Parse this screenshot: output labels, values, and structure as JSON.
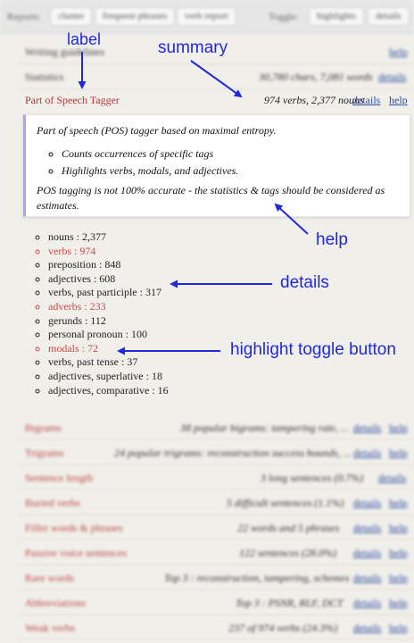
{
  "toolbar": {
    "reports_label": "Reports:",
    "buttons": [
      "cluster",
      "frequent phrases",
      "verb report"
    ],
    "toggle_label": "Toggle:",
    "toggles": [
      "highlights",
      "details"
    ]
  },
  "top_rows": [
    {
      "label": "Writing guidelines",
      "summary": "",
      "details": "",
      "help": "help"
    },
    {
      "label": "Statistics",
      "summary": "30,780 chars, 7,081 words",
      "details": "details",
      "help": ""
    }
  ],
  "tagger": {
    "label": "Part of Speech Tagger",
    "summary": "974 verbs, 2,377 nouns",
    "details": "details",
    "help": "help"
  },
  "help_box": {
    "intro": "Part of speech (POS) tagger based on maximal entropy.",
    "bullets": [
      "Counts occurrences of specific tags",
      "Highlights verbs, modals, and adjectives."
    ],
    "note": "POS tagging is not 100% accurate - the statistics & tags should be considered as estimates."
  },
  "counts": [
    {
      "text": "nouns : 2,377",
      "highlight": false
    },
    {
      "text": "verbs : 974",
      "highlight": true
    },
    {
      "text": "preposition : 848",
      "highlight": false
    },
    {
      "text": "adjectives : 608",
      "highlight": false
    },
    {
      "text": "verbs, past participle : 317",
      "highlight": false
    },
    {
      "text": "adverbs : 233",
      "highlight": true
    },
    {
      "text": "gerunds : 112",
      "highlight": false
    },
    {
      "text": "personal pronoun : 100",
      "highlight": false
    },
    {
      "text": "modals : 72",
      "highlight": true
    },
    {
      "text": "verbs, past tense : 37",
      "highlight": false
    },
    {
      "text": "adjectives, superlative : 18",
      "highlight": false
    },
    {
      "text": "adjectives, comparative : 16",
      "highlight": false
    }
  ],
  "bottom_rows": [
    {
      "label": "Bigrams",
      "summary": "38 popular bigrams: tampering rate, ...",
      "details": "details",
      "help": "help"
    },
    {
      "label": "Trigrams",
      "summary": "24 popular trigrams: reconstruction success bounds, ...",
      "details": "details",
      "help": "help"
    },
    {
      "label": "Sentence length",
      "summary": "3 long sentences (0.7%)",
      "details": "details",
      "help": ""
    },
    {
      "label": "Buried verbs",
      "summary": "5 difficult sentences (1.1%)",
      "details": "details",
      "help": "help"
    },
    {
      "label": "Filler words & phrases",
      "summary": "22 words and 5 phrases",
      "details": "details",
      "help": "help"
    },
    {
      "label": "Passive voice sentences",
      "summary": "122 sentences (28.0%)",
      "details": "details",
      "help": "help"
    },
    {
      "label": "Rare words",
      "summary": "Top 3 : reconstruction, tampering, schemes",
      "details": "details",
      "help": "help"
    },
    {
      "label": "Abbreviations",
      "summary": "Top 3 : PSNR, RLF, DCT",
      "details": "details",
      "help": "help"
    },
    {
      "label": "Weak verbs",
      "summary": "237 of 974 verbs (24.3%)",
      "details": "details",
      "help": "help"
    }
  ],
  "annotations": {
    "label": "label",
    "summary": "summary",
    "help": "help",
    "details": "details",
    "highlight": "highlight toggle button",
    "color": "#2028d8"
  },
  "colors": {
    "label_red": "#b33333",
    "link_blue": "#2a4da0",
    "highlight_red": "#c74a4a",
    "background": "#f1efea"
  }
}
